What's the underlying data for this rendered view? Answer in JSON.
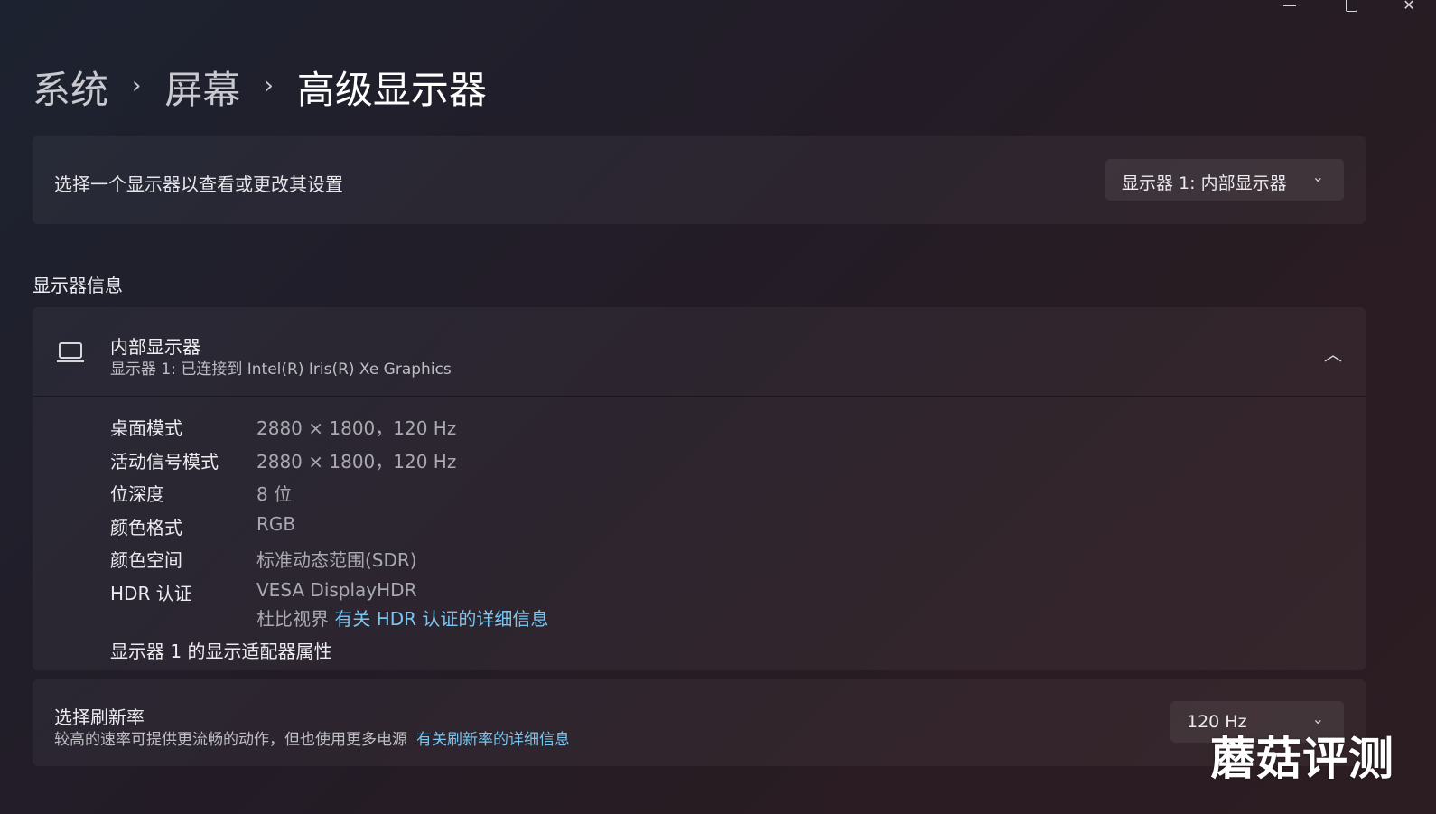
{
  "window_controls": {
    "minimize": "minimize",
    "maximize": "maximize",
    "close": "✕"
  },
  "breadcrumb": {
    "items": [
      "系统",
      "屏幕",
      "高级显示器"
    ],
    "separator": "›"
  },
  "display_select": {
    "label": "选择一个显示器以查看或更改其设置",
    "selected": "显示器 1: 内部显示器"
  },
  "section_title": "显示器信息",
  "display_info": {
    "title": "内部显示器",
    "subtitle": "显示器 1: 已连接到 Intel(R) Iris(R) Xe Graphics",
    "icon": "laptop-icon",
    "rows": [
      {
        "key": "桌面模式",
        "value": "2880 × 1800，120 Hz"
      },
      {
        "key": "活动信号模式",
        "value": "2880 × 1800，120 Hz"
      },
      {
        "key": "位深度",
        "value": "8 位"
      },
      {
        "key": "颜色格式",
        "value": "RGB"
      },
      {
        "key": "颜色空间",
        "value": "标准动态范围(SDR)"
      },
      {
        "key": "HDR 认证",
        "value": "VESA DisplayHDR"
      }
    ],
    "hdr_extra_prefix": "杜比视界",
    "hdr_link": "有关 HDR 认证的详细信息",
    "adapter_link": "显示器 1 的显示适配器属性"
  },
  "refresh": {
    "title": "选择刷新率",
    "description": "较高的速率可提供更流畅的动作，但也使用更多电源",
    "link": "有关刷新率的详细信息",
    "selected": "120 Hz"
  },
  "watermark": "蘑菇评测",
  "colors": {
    "accent_link": "#79c5ef",
    "background": "#231c26"
  }
}
